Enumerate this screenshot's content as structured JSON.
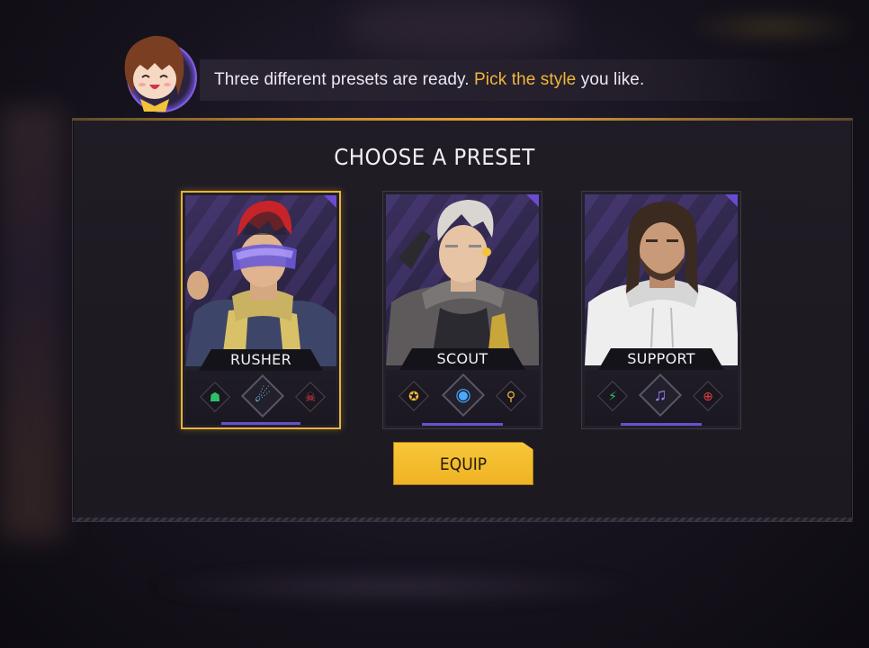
{
  "dialog": {
    "text_before": "Three different presets are ready. ",
    "highlight": "Pick the style",
    "text_after": " you like.",
    "highlight_color": "#f2b63a"
  },
  "panel": {
    "title": "CHOOSE A PRESET"
  },
  "presets": [
    {
      "label": "RUSHER",
      "selected": true,
      "skills": [
        "shield-skull-icon",
        "comet-icon",
        "target-skull-icon"
      ],
      "skill_colors": [
        "#2fbf6a",
        "#7fd0ff",
        "#e04040"
      ]
    },
    {
      "label": "SCOUT",
      "selected": false,
      "skills": [
        "winged-emblem-icon",
        "eye-scan-icon",
        "radar-icon"
      ],
      "skill_colors": [
        "#f2b63a",
        "#4aa8ff",
        "#f2b63a"
      ]
    },
    {
      "label": "SUPPORT",
      "selected": false,
      "skills": [
        "runner-icon",
        "music-note-icon",
        "crosshair-icon"
      ],
      "skill_colors": [
        "#2fbf6a",
        "#9b7bff",
        "#e04040"
      ]
    }
  ],
  "equip": {
    "label": "EQUIP",
    "color": "#f2bd2e"
  },
  "colors": {
    "accent": "#e8b33a",
    "panel_bg": "#1f1b24",
    "card_accent": "#6c4fcf"
  }
}
